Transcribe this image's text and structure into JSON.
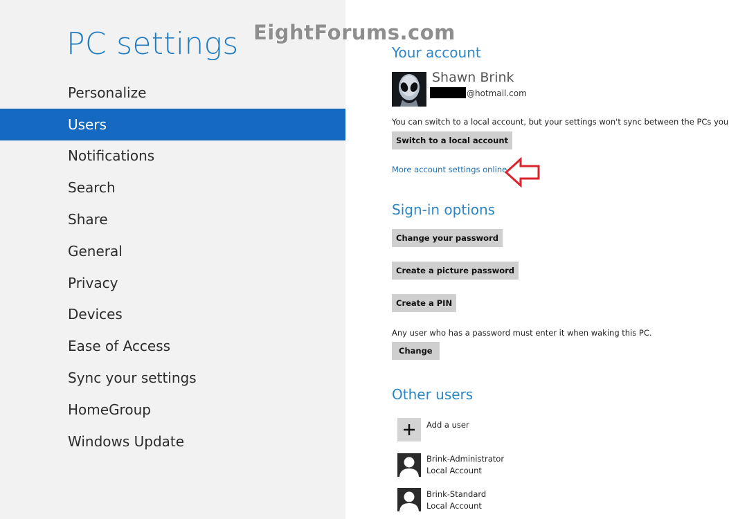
{
  "watermark": "EightForums.com",
  "sidebar": {
    "title": "PC settings",
    "items": [
      {
        "label": "Personalize"
      },
      {
        "label": "Users"
      },
      {
        "label": "Notifications"
      },
      {
        "label": "Search"
      },
      {
        "label": "Share"
      },
      {
        "label": "General"
      },
      {
        "label": "Privacy"
      },
      {
        "label": "Devices"
      },
      {
        "label": "Ease of Access"
      },
      {
        "label": "Sync your settings"
      },
      {
        "label": "HomeGroup"
      },
      {
        "label": "Windows Update"
      }
    ],
    "selected": "Users"
  },
  "account": {
    "title": "Your account",
    "name": "Shawn Brink",
    "email_suffix": "@hotmail.com",
    "switch_text": "You can switch to a local account, but your settings won't sync between the PCs you use.",
    "switch_button": "Switch to a local account",
    "more_link": "More account settings online"
  },
  "signin": {
    "title": "Sign-in options",
    "change_password_button": "Change your password",
    "picture_password_button": "Create a picture password",
    "pin_button": "Create a PIN",
    "wake_text": "Any user who has a password must enter it when waking this PC.",
    "change_button": "Change"
  },
  "other_users": {
    "title": "Other users",
    "add_label": "Add a user",
    "users": [
      {
        "name": "Brink-Administrator",
        "type": "Local Account"
      },
      {
        "name": "Brink-Standard",
        "type": "Local Account"
      }
    ]
  },
  "colors": {
    "accent": "#1569c0",
    "section_title": "#2b86c5",
    "annotation_arrow": "#d9232d"
  }
}
